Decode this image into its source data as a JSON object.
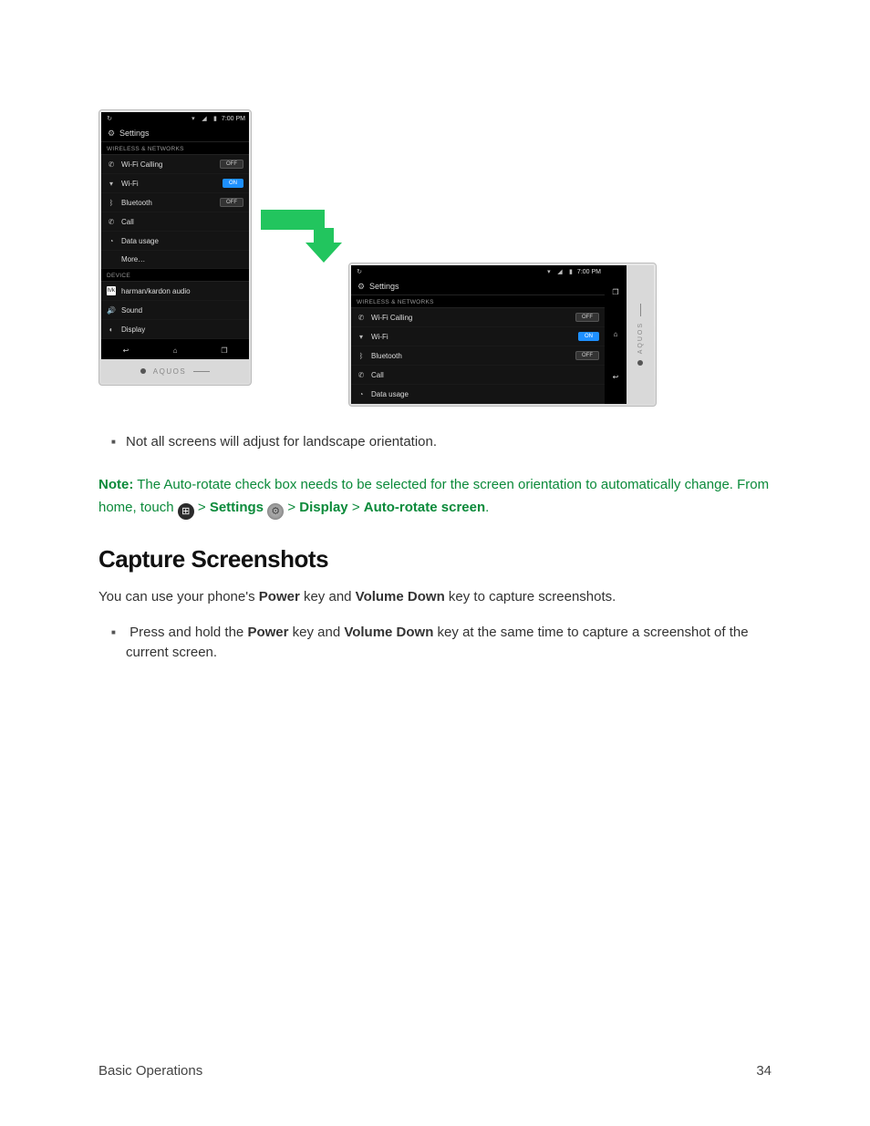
{
  "phone": {
    "status_time": "7:00 PM",
    "settings_title": "Settings",
    "section_wireless": "WIRELESS & NETWORKS",
    "section_device": "DEVICE",
    "rows": {
      "wifi_calling": "Wi-Fi Calling",
      "wifi": "Wi-Fi",
      "bluetooth": "Bluetooth",
      "call": "Call",
      "data_usage": "Data usage",
      "more": "More…",
      "hk_audio": "harman/kardon audio",
      "sound": "Sound",
      "display": "Display"
    },
    "toggles": {
      "off": "OFF",
      "on": "ON"
    },
    "brand": "AQUOS"
  },
  "bullets": {
    "b1": "Not all screens will adjust for landscape orientation."
  },
  "note": {
    "label": "Note:",
    "t1": " The Auto-rotate check box needs to be selected for the screen orientation to automatically change. From home, touch ",
    "sep": " > ",
    "kw_settings": "Settings",
    "kw_display": "Display",
    "kw_autorotate": "Auto-rotate screen",
    "period": "."
  },
  "section_heading": "Capture Screenshots",
  "para": {
    "t1": "You can use your phone's ",
    "kw_power": "Power",
    "t2": " key and ",
    "kw_voldown": "Volume Down",
    "t3": " key to capture screenshots."
  },
  "bullet2": {
    "t1": "Press and hold the ",
    "kw_power": "Power",
    "t2": " key and ",
    "kw_voldown": "Volume Down",
    "t3": " key at the same time to capture a screenshot of the current screen."
  },
  "footer": {
    "left": "Basic Operations",
    "right": "34"
  }
}
